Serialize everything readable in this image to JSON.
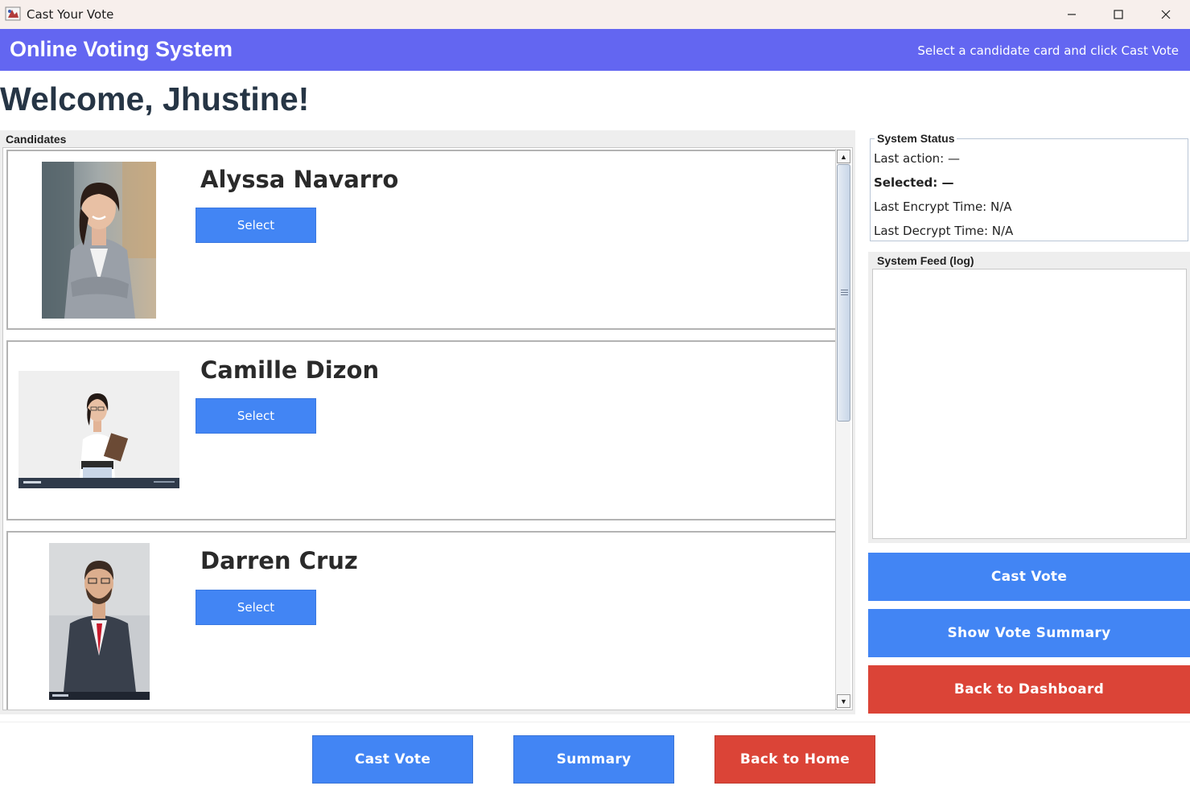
{
  "window": {
    "title": "Cast Your Vote",
    "icon": "java-cup-icon"
  },
  "header": {
    "title": "Online Voting System",
    "hint": "Select a candidate card and click Cast Vote",
    "color": "#6366f1"
  },
  "welcome": "Welcome, Jhustine!",
  "candidates": {
    "legend": "Candidates",
    "items": [
      {
        "name": "Alyssa Navarro",
        "select_label": "Select",
        "photo": "woman-blazer-photo"
      },
      {
        "name": "Camille Dizon",
        "select_label": "Select",
        "photo": "woman-tablet-photo"
      },
      {
        "name": "Darren Cruz",
        "select_label": "Select",
        "photo": "man-suit-photo"
      }
    ]
  },
  "status": {
    "legend": "System Status",
    "last_action": "Last action: —",
    "selected": "Selected: —",
    "encrypt_time": "Last Encrypt Time: N/A",
    "decrypt_time": "Last Decrypt Time: N/A"
  },
  "feed": {
    "legend": "System Feed (log)",
    "content": ""
  },
  "side_actions": {
    "cast_vote": "Cast Vote",
    "show_summary": "Show Vote Summary",
    "back_dashboard": "Back to Dashboard"
  },
  "bottom_actions": {
    "cast_vote": "Cast Vote",
    "summary": "Summary",
    "back_home": "Back to Home"
  },
  "colors": {
    "primary_blue": "#4285f4",
    "danger_red": "#db4437",
    "header_purple": "#6366f1"
  }
}
